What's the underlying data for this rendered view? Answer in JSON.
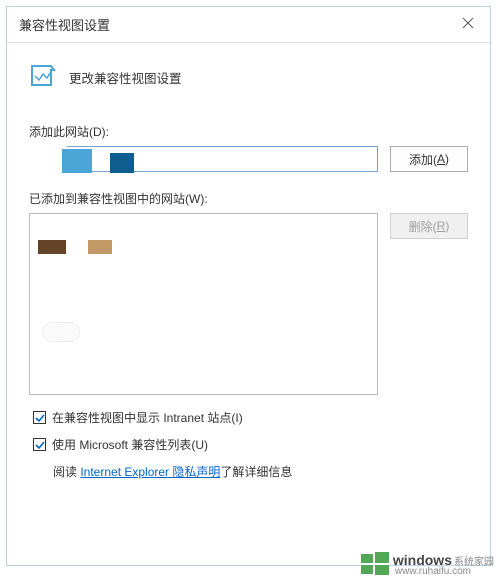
{
  "titlebar": {
    "title": "兼容性视图设置"
  },
  "header": {
    "text": "更改兼容性视图设置"
  },
  "addSection": {
    "label": "添加此网站(D):",
    "buttonText": "添加(",
    "buttonKey": "A",
    "buttonSuffix": ")"
  },
  "listSection": {
    "label": "已添加到兼容性视图中的网站(W):",
    "removeButtonText": "删除(",
    "removeButtonKey": "R",
    "removeButtonSuffix": ")"
  },
  "checkboxes": {
    "intranet": "在兼容性视图中显示 Intranet 站点(I)",
    "microsoft": "使用 Microsoft 兼容性列表(U)"
  },
  "privacy": {
    "prefix": "阅读 ",
    "linkText": "Internet Explorer 隐私声明",
    "suffix": "了解详细信息"
  },
  "watermark": {
    "brand": "windows",
    "sub": "系统家园",
    "url": "www.ruhaifu.com"
  }
}
